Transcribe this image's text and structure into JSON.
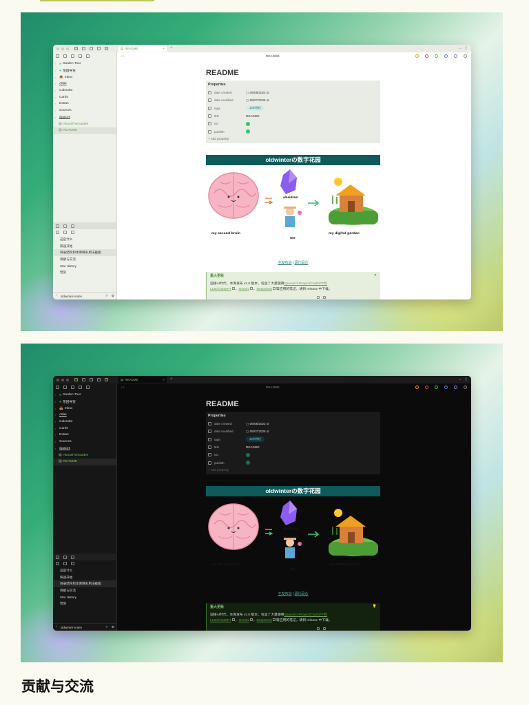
{
  "page": {
    "section_heading": "贡献与交流"
  },
  "app": {
    "tab_title": "README",
    "nav_title": "README",
    "vault_name": "oldwinter-notes",
    "tree": [
      {
        "label": "Garden Tour",
        "type": "folder",
        "emoji": "🟢"
      },
      {
        "label": "花园导览",
        "type": "folder",
        "emoji": "🟢"
      },
      {
        "label": "Inbox",
        "type": "folder",
        "emoji": "📥"
      },
      {
        "label": "Atlas",
        "type": "folder",
        "underline": true
      },
      {
        "label": "Calendar",
        "type": "folder"
      },
      {
        "label": "Cards",
        "type": "folder"
      },
      {
        "label": "Extras",
        "type": "folder"
      },
      {
        "label": "Sources",
        "type": "folder"
      },
      {
        "label": "Spaces",
        "type": "folder",
        "underline": true
      },
      {
        "label": "AboutTheGarden",
        "type": "file"
      },
      {
        "label": "README",
        "type": "file",
        "selected": true
      }
    ],
    "outline": [
      {
        "label": "这是什么"
      },
      {
        "label": "快速开始"
      },
      {
        "label": "目录结构和本库精彩用法截图",
        "selected": true
      },
      {
        "label": "贡献与交流"
      },
      {
        "label": "Star History"
      },
      {
        "label": "赞赏"
      }
    ],
    "doc": {
      "title": "README",
      "properties_label": "Properties",
      "properties": [
        {
          "key": "date created",
          "icon": "calendar-icon",
          "value": "06/08/2022",
          "kind": "date"
        },
        {
          "key": "date modified",
          "icon": "calendar-icon",
          "value": "08/07/2025",
          "kind": "date"
        },
        {
          "key": "tags",
          "icon": "tag-icon",
          "value": "本库教程",
          "kind": "tag"
        },
        {
          "key": "title",
          "icon": "text-icon",
          "value": "README",
          "kind": "text"
        },
        {
          "key": "toc",
          "icon": "checkbox-icon",
          "value": "",
          "kind": "check"
        },
        {
          "key": "publish",
          "icon": "checkbox-icon",
          "value": "",
          "kind": "check"
        }
      ],
      "add_property": "+ Add property",
      "banner": "oldwinterの数字花园",
      "illus_labels": {
        "brain": "my second brain",
        "obsidian": "obsidian",
        "me": "me",
        "garden": "my digital garden"
      },
      "link1": "主发布站",
      "link_sep": " | ",
      "link2": "源代码仓",
      "callout_title": "重大更新",
      "callout_body_1": "迎接AI时代，本库发布 v2.0 版本，包含了大量使用",
      "callout_link_1": "Spaces/1-Project/ChatGPT和",
      "callout_link_2": "LLM/ChatGPT",
      "callout_link_3": "Gemini",
      "callout_link_4": "DeepSeek",
      "callout_body_2": "等应用的笔记，请到 release 中下载。",
      "comma": "，"
    },
    "colors": {
      "accent": "#6a9b50",
      "banner": "#0f5a5b",
      "check": "#3bbf73",
      "tag_bg": "#d6ebe9"
    }
  }
}
